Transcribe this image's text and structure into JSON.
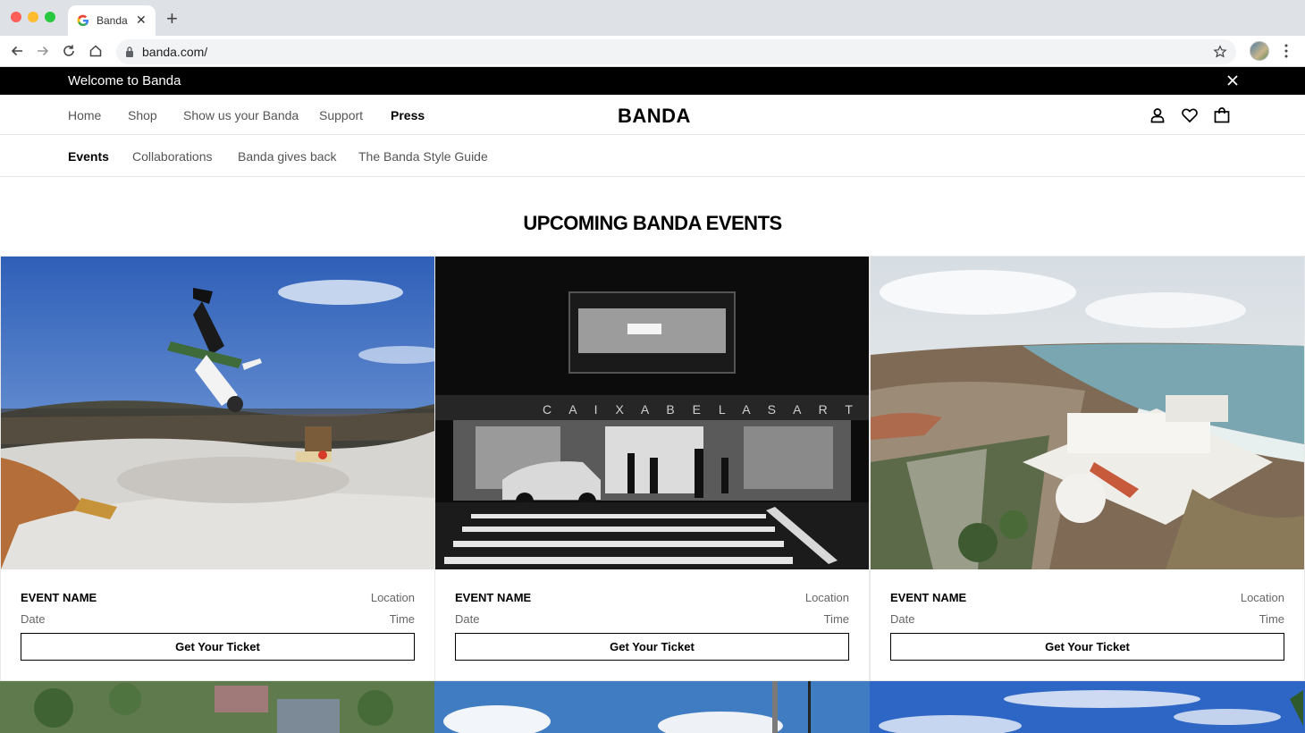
{
  "browser": {
    "tab_title": "Banda",
    "url": "banda.com/"
  },
  "announcement": {
    "message": "Welcome to Banda"
  },
  "main_nav": {
    "items": [
      {
        "label": "Home"
      },
      {
        "label": "Shop"
      },
      {
        "label": "Show us your Banda"
      },
      {
        "label": "Support"
      },
      {
        "label": "Press"
      }
    ],
    "active": "Press",
    "logo": "BANDA"
  },
  "sub_nav": {
    "items": [
      {
        "label": "Events"
      },
      {
        "label": "Collaborations"
      },
      {
        "label": "Banda gives back"
      },
      {
        "label": "The Banda Style Guide"
      }
    ],
    "active": "Events"
  },
  "section": {
    "title": "UPCOMING BANDA EVENTS"
  },
  "events": [
    {
      "name": "EVENT NAME",
      "location": "Location",
      "date": "Date",
      "time": "Time",
      "cta": "Get Your Ticket",
      "image": "skatepark-photo"
    },
    {
      "name": "EVENT NAME",
      "location": "Location",
      "date": "Date",
      "time": "Time",
      "cta": "Get Your Ticket",
      "image": "city-street-night-photo"
    },
    {
      "name": "EVENT NAME",
      "location": "Location",
      "date": "Date",
      "time": "Time",
      "cta": "Get Your Ticket",
      "image": "coastal-castle-aerial-photo"
    }
  ],
  "colors": {
    "announcement_bg": "#000000",
    "text_primary": "#000000",
    "text_secondary": "#555555",
    "divider": "#e5e5e5"
  }
}
